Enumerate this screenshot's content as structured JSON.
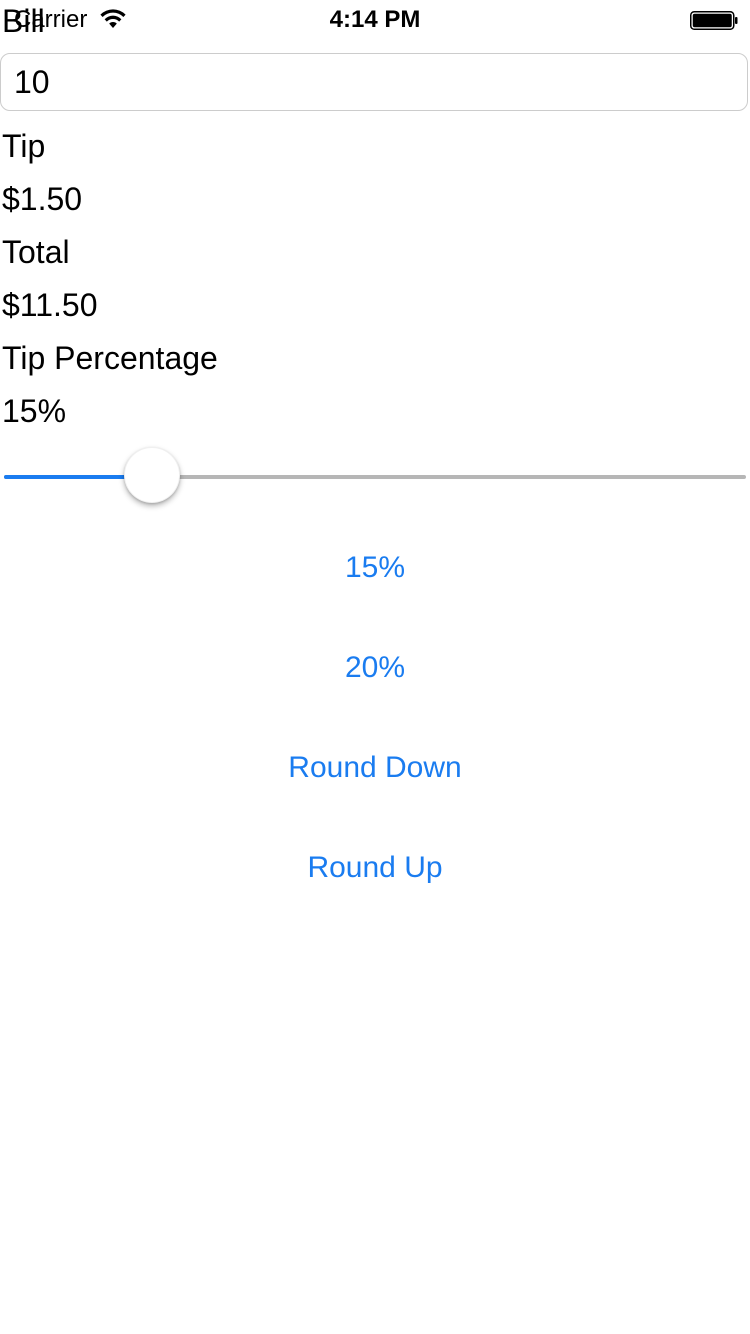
{
  "status_bar": {
    "carrier": "Carrier",
    "time": "4:14 PM",
    "icons": [
      "wifi-icon",
      "battery-icon"
    ]
  },
  "form": {
    "bill_label": "Bill",
    "bill_value": "10",
    "tip_label": "Tip",
    "tip_value": "$1.50",
    "total_label": "Total",
    "total_value": "$11.50",
    "tip_percentage_label": "Tip Percentage",
    "tip_percentage_value": "15%"
  },
  "slider": {
    "value": 0.175
  },
  "buttons": {
    "tip_15": "15%",
    "tip_20": "20%",
    "round_down": "Round Down",
    "round_up": "Round Up"
  },
  "colors": {
    "accent": "#1a7cf0",
    "track": "#b6b6b6",
    "text": "#000000",
    "background": "#ffffff"
  }
}
